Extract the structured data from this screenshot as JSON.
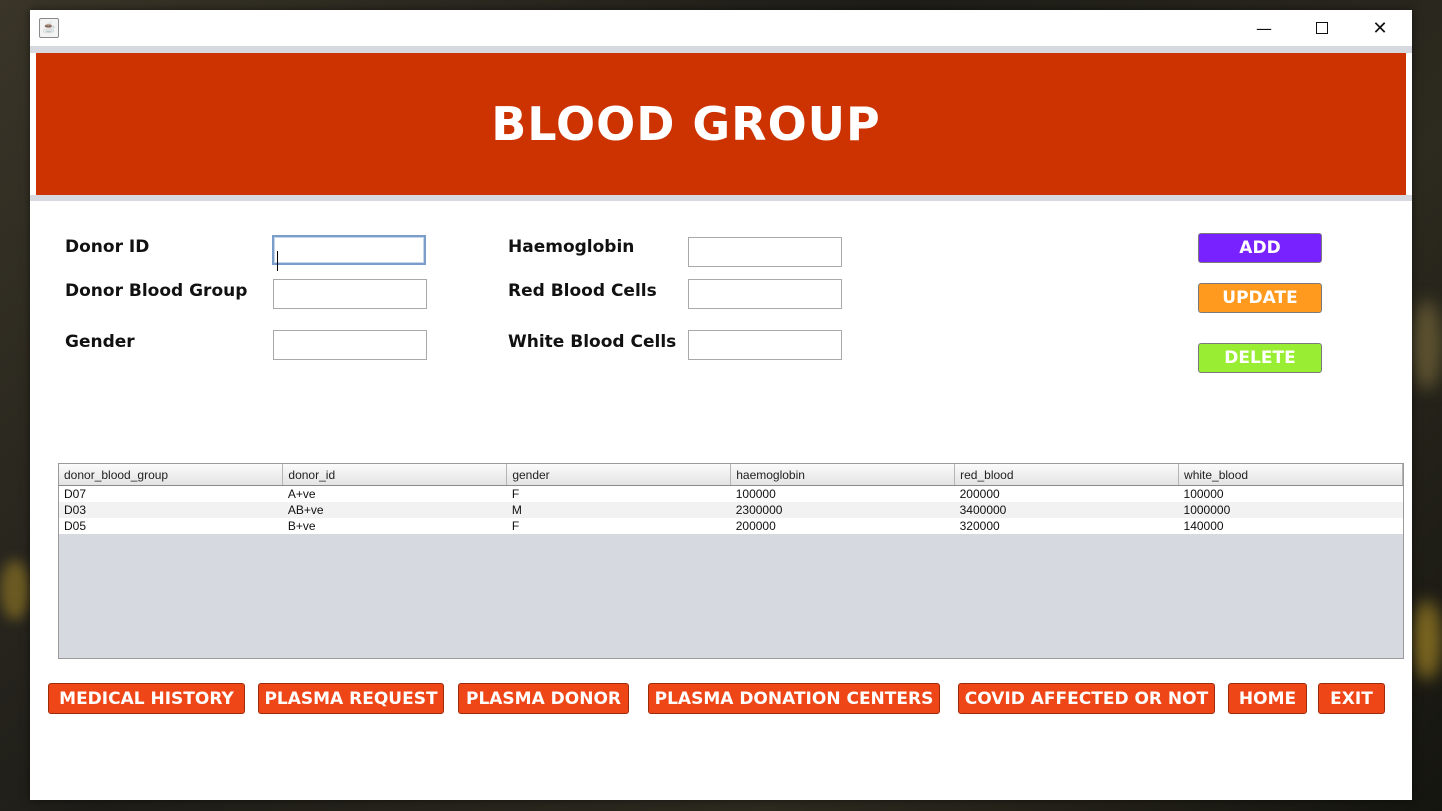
{
  "window": {
    "icon": "java-icon",
    "controls": {
      "minimize": "—",
      "maximize": "□",
      "close": "✕"
    }
  },
  "header": {
    "title": "BLOOD GROUP"
  },
  "form": {
    "labels": {
      "donor_id": "Donor ID",
      "donor_blood_group": "Donor Blood Group",
      "gender": "Gender",
      "haemoglobin": "Haemoglobin",
      "red_blood_cells": "Red Blood Cells",
      "white_blood_cells": "White Blood Cells"
    },
    "values": {
      "donor_id": "",
      "donor_blood_group": "",
      "gender": "",
      "haemoglobin": "",
      "red_blood_cells": "",
      "white_blood_cells": ""
    }
  },
  "actions": {
    "add": "ADD",
    "update": "UPDATE",
    "delete": "DELETE",
    "colors": {
      "add": "#7722ff",
      "update": "#ff9a1f",
      "delete": "#99ee33"
    }
  },
  "table": {
    "columns": [
      "donor_blood_group",
      "donor_id",
      "gender",
      "haemoglobin",
      "red_blood",
      "white_blood"
    ],
    "rows": [
      [
        "D07",
        "A+ve",
        "F",
        "100000",
        "200000",
        "100000"
      ],
      [
        "D03",
        "AB+ve",
        "M",
        "2300000",
        "3400000",
        "1000000"
      ],
      [
        "D05",
        "B+ve",
        "F",
        "200000",
        "320000",
        "140000"
      ]
    ]
  },
  "nav": {
    "medical_history": "MEDICAL HISTORY",
    "plasma_request": "PLASMA REQUEST",
    "plasma_donor": "PLASMA DONOR",
    "plasma_donation_centers": "PLASMA DONATION CENTERS",
    "covid_affected": "COVID AFFECTED OR NOT",
    "home": "HOME",
    "exit": "EXIT"
  },
  "colors": {
    "header": "#cc3300",
    "nav_button": "#ef4618"
  }
}
